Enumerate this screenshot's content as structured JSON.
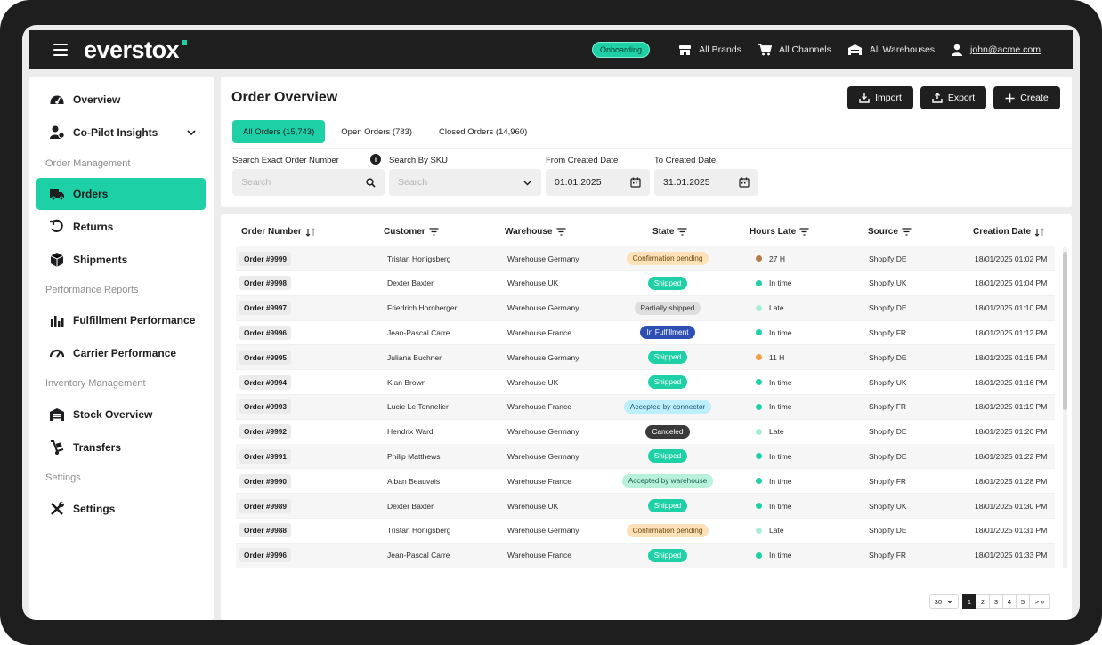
{
  "header": {
    "brand": "everstox",
    "onboarding": "Onboarding",
    "brands": "All Brands",
    "channels": "All Channels",
    "warehouses": "All Warehouses",
    "user": "john@acme.com"
  },
  "sidebar": {
    "overview": "Overview",
    "copilot": "Co-Pilot Insights",
    "section_orders": "Order Management",
    "orders": "Orders",
    "returns": "Returns",
    "shipments": "Shipments",
    "section_performance": "Performance Reports",
    "fulfillment": "Fulfillment Performance",
    "carrier": "Carrier Performance",
    "section_inventory": "Inventory Management",
    "stock": "Stock Overview",
    "transfers": "Transfers",
    "section_settings": "Settings",
    "settings": "Settings"
  },
  "page": {
    "title": "Order Overview",
    "import": "Import",
    "export": "Export",
    "create": "Create"
  },
  "tabs": {
    "all": "All Orders (15,743)",
    "open": "Open Orders (783)",
    "closed": "Closed Orders (14,960)"
  },
  "filters": {
    "order_label": "Search Exact Order Number",
    "order_placeholder": "Search",
    "sku_label": "Search By SKU",
    "sku_placeholder": "Search",
    "from_label": "From Created Date",
    "from_value": "01.01.2025",
    "to_label": "To Created Date",
    "to_value": "31.01.2025"
  },
  "table": {
    "columns": {
      "order": "Order Number",
      "customer": "Customer",
      "warehouse": "Warehouse",
      "state": "State",
      "hours": "Hours Late",
      "source": "Source",
      "date": "Creation Date"
    },
    "rows": [
      {
        "order": "Order #9999",
        "customer": "Tristan Honigsberg",
        "warehouse": "Warehouse Germany",
        "state": "Confirmation pending",
        "hours": "27 H",
        "source": "Shopify DE",
        "date": "18/01/2025 01:02 PM"
      },
      {
        "order": "Order #9998",
        "customer": "Dexter Baxter",
        "warehouse": "Warehouse UK",
        "state": "Shipped",
        "hours": "In time",
        "source": "Shopify UK",
        "date": "18/01/2025 01:04 PM"
      },
      {
        "order": "Order #9997",
        "customer": "Friedrich Hornberger",
        "warehouse": "Warehouse Germany",
        "state": "Partially shipped",
        "hours": "Late",
        "source": "Shopify DE",
        "date": "18/01/2025 01:10 PM"
      },
      {
        "order": "Order #9996",
        "customer": "Jean-Pascal Carre",
        "warehouse": "Warehouse France",
        "state": "In Fulfillment",
        "hours": "In time",
        "source": "Shopify FR",
        "date": "18/01/2025 01:12 PM"
      },
      {
        "order": "Order #9995",
        "customer": "Juliana Buchner",
        "warehouse": "Warehouse Germany",
        "state": "Shipped",
        "hours": "11 H",
        "source": "Shopify DE",
        "date": "18/01/2025 01:15 PM"
      },
      {
        "order": "Order #9994",
        "customer": "Kian Brown",
        "warehouse": "Warehouse UK",
        "state": "Shipped",
        "hours": "In time",
        "source": "Shopify UK",
        "date": "18/01/2025 01:16 PM"
      },
      {
        "order": "Order #9993",
        "customer": "Lucie Le Tonnelier",
        "warehouse": "Warehouse France",
        "state": "Accepted by connector",
        "hours": "In time",
        "source": "Shopify FR",
        "date": "18/01/2025 01:19 PM"
      },
      {
        "order": "Order #9992",
        "customer": "Hendrix Ward",
        "warehouse": "Warehouse Germany",
        "state": "Canceled",
        "hours": "Late",
        "source": "Shopify DE",
        "date": "18/01/2025 01:20 PM"
      },
      {
        "order": "Order #9991",
        "customer": "Philip Matthews",
        "warehouse": "Warehouse Germany",
        "state": "Shipped",
        "hours": "In time",
        "source": "Shopify DE",
        "date": "18/01/2025 01:22 PM"
      },
      {
        "order": "Order #9990",
        "customer": "Alban Beauvais",
        "warehouse": "Warehouse France",
        "state": "Accepted by warehouse",
        "hours": "In time",
        "source": "Shopify FR",
        "date": "18/01/2025 01:28 PM"
      },
      {
        "order": "Order #9989",
        "customer": "Dexter Baxter",
        "warehouse": "Warehouse UK",
        "state": "Shipped",
        "hours": "In time",
        "source": "Shopify UK",
        "date": "18/01/2025 01:30 PM"
      },
      {
        "order": "Order #9988",
        "customer": "Tristan Honigsberg",
        "warehouse": "Warehouse Germany",
        "state": "Confirmation pending",
        "hours": "Late",
        "source": "Shopify DE",
        "date": "18/01/2025 01:31 PM"
      },
      {
        "order": "Order #9996",
        "customer": "Jean-Pascal Carre",
        "warehouse": "Warehouse France",
        "state": "Shipped",
        "hours": "In time",
        "source": "Shopify FR",
        "date": "18/01/2025 01:33 PM"
      }
    ]
  },
  "state_styles": {
    "Confirmation pending": {
      "bg": "#fde1b8",
      "fg": "#6b4a14"
    },
    "Shipped": {
      "bg": "#1ed0a6",
      "fg": "#ffffff"
    },
    "Partially shipped": {
      "bg": "#dedede",
      "fg": "#333333"
    },
    "In Fulfillment": {
      "bg": "#2d4fb3",
      "fg": "#ffffff"
    },
    "Accepted by connector": {
      "bg": "#bdeefc",
      "fg": "#1b5666"
    },
    "Canceled": {
      "bg": "#3a3a3a",
      "fg": "#ffffff"
    },
    "Accepted by warehouse": {
      "bg": "#b8f0dc",
      "fg": "#19604c"
    }
  },
  "hours_colors": {
    "In time": "#1ed0a6",
    "Late": "#a8ecd9",
    "27 H": "#b07d4a",
    "11 H": "#f0a145"
  },
  "pagination": {
    "page_size": "30",
    "pages": [
      "1",
      "2",
      "3",
      "4",
      "5"
    ],
    "current": "1",
    "next": ">",
    "last": "»"
  },
  "colors": {
    "accent": "#1ed0a6",
    "dark": "#1f1f1f"
  }
}
